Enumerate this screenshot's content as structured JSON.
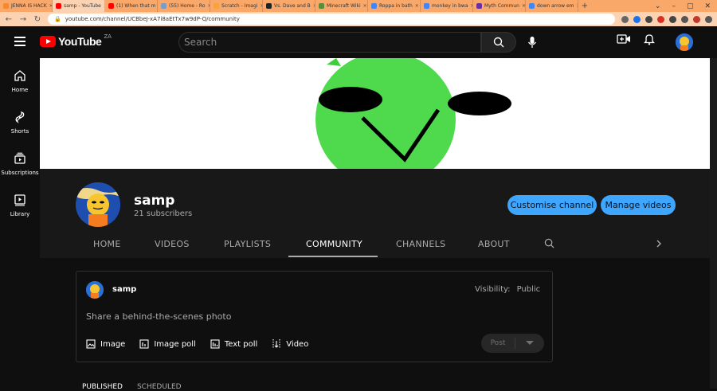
{
  "browser": {
    "tabs": [
      {
        "title": "JENNA IS HACK",
        "color": "#f28b30"
      },
      {
        "title": "samp - YouTube",
        "color": "#ff0000"
      },
      {
        "title": "(1) When that m",
        "color": "#ff0000"
      },
      {
        "title": "(55) Home - Ro",
        "color": "#7a9cc6"
      },
      {
        "title": "Scratch - Imagi",
        "color": "#f7a23b"
      },
      {
        "title": "Vs. Dave and B",
        "color": "#222222"
      },
      {
        "title": "Minecraft Wiki",
        "color": "#5b8c3a"
      },
      {
        "title": "Roppa in bath",
        "color": "#4285f4"
      },
      {
        "title": "monkey in bwa",
        "color": "#4285f4"
      },
      {
        "title": "Myth Commun",
        "color": "#6a2fa0"
      },
      {
        "title": "down arrow em",
        "color": "#4285f4"
      }
    ],
    "active_tab_index": 1,
    "new_tab": "+",
    "window_controls": [
      "⌄",
      "–",
      "▢",
      "✕"
    ],
    "url": "youtube.com/channel/UCBbeJ-xA7i8aEtTx7w9dP-Q/community"
  },
  "header": {
    "logo_text": "YouTube",
    "country_code": "ZA",
    "search_placeholder": "Search"
  },
  "leftnav": {
    "items": [
      {
        "label": "Home",
        "icon": "home-icon"
      },
      {
        "label": "Shorts",
        "icon": "shorts-icon"
      },
      {
        "label": "Subscriptions",
        "icon": "subscriptions-icon"
      },
      {
        "label": "Library",
        "icon": "library-icon"
      }
    ]
  },
  "channel": {
    "name": "samp",
    "subscribers": "21 subscribers",
    "customise_label": "Customise channel",
    "manage_label": "Manage videos",
    "tabs": [
      "HOME",
      "VIDEOS",
      "PLAYLISTS",
      "COMMUNITY",
      "CHANNELS",
      "ABOUT"
    ],
    "active_tab": "COMMUNITY"
  },
  "post": {
    "author": "samp",
    "visibility_label": "Visibility:",
    "visibility_value": "Public",
    "prompt": "Share a behind-the-scenes photo",
    "actions": [
      {
        "label": "Image",
        "icon": "image-icon"
      },
      {
        "label": "Image poll",
        "icon": "image-poll-icon"
      },
      {
        "label": "Text poll",
        "icon": "text-poll-icon"
      },
      {
        "label": "Video",
        "icon": "video-icon"
      }
    ],
    "post_label": "Post"
  },
  "subtabs": {
    "published": "PUBLISHED",
    "scheduled": "SCHEDULED"
  },
  "colors": {
    "accent_blue": "#3ea6ff",
    "brand_red": "#ff0000",
    "background": "#0f0f0f",
    "banner_green": "#4fd94c"
  }
}
